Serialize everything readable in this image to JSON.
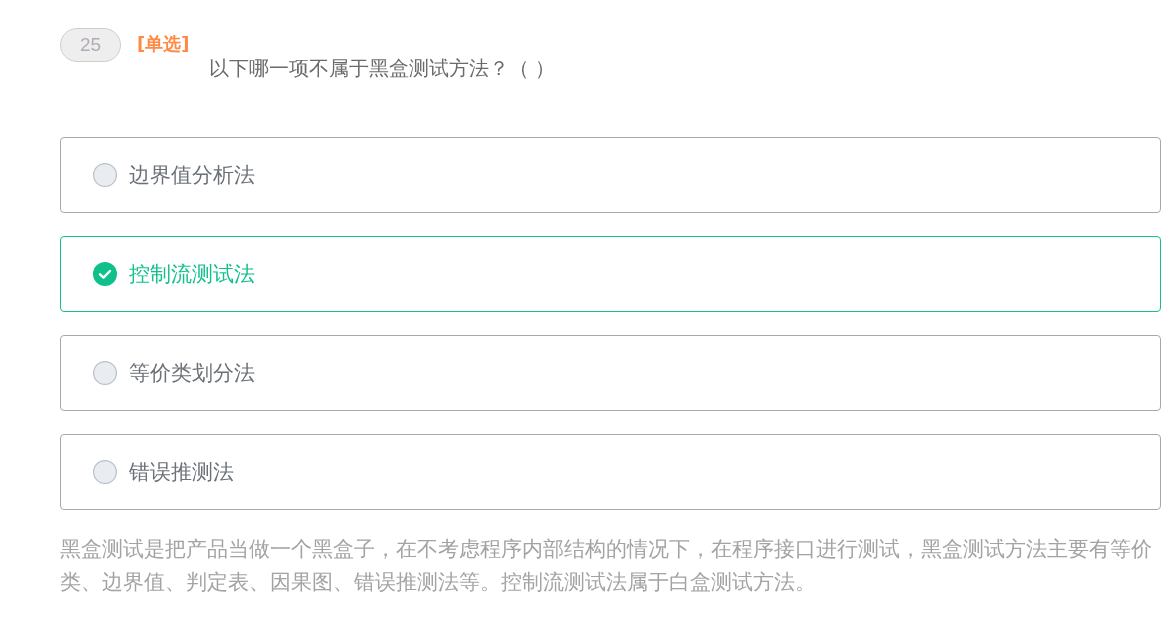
{
  "question": {
    "number": "25",
    "type_tag": "[单选]",
    "text": "以下哪一项不属于黑盒测试方法？（ ）"
  },
  "options": [
    {
      "label": "边界值分析法",
      "selected": false
    },
    {
      "label": "控制流测试法",
      "selected": true
    },
    {
      "label": "等价类划分法",
      "selected": false
    },
    {
      "label": "错误推测法",
      "selected": false
    }
  ],
  "explanation": "黑盒测试是把产品当做一个黑盒子，在不考虑程序内部结构的情况下，在程序接口进行测试，黑盒测试方法主要有等价类、边界值、判定表、因果图、错误推测法等。控制流测试法属于白盒测试方法。"
}
